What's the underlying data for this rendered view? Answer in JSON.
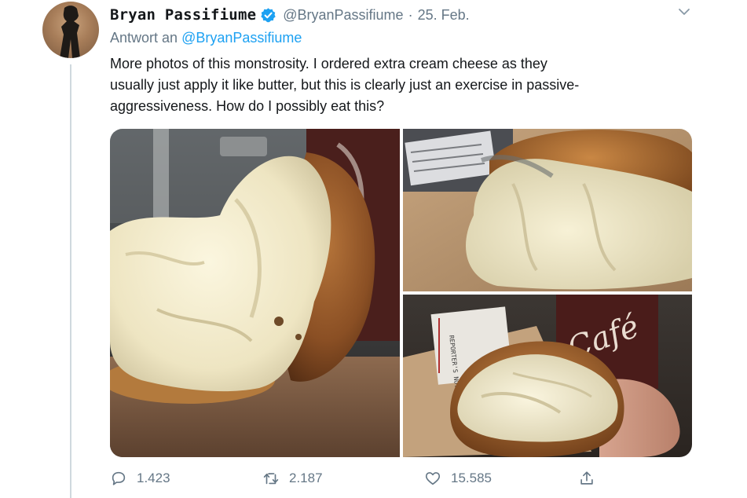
{
  "tweet": {
    "display_name": "Bryan Passifiume",
    "handle": "@BryanPassifiume",
    "separator": "·",
    "date": "25. Feb.",
    "reply_prefix": "Antwort an",
    "reply_mention": "@BryanPassifiume",
    "text_lines": [
      "More photos of this monstrosity. I ordered extra cream cheese as they",
      "usually just apply it like butter, but this is clearly just an exercise in passive-",
      "aggressiveness. How do I possibly eat this?"
    ],
    "verified": true
  },
  "media": {
    "photos": [
      {
        "subject": "bagel with heaped cream cheese, side view"
      },
      {
        "subject": "bagel with cream cheese, close-up"
      },
      {
        "subject": "bagel held in hand in front of café cup and notepad"
      }
    ],
    "cup_label": "Café",
    "notepad_text": "REPORTER'S NOTEBOOK"
  },
  "actions": {
    "reply_count": "1.423",
    "retweet_count": "2.187",
    "like_count": "15.585"
  },
  "colors": {
    "accent": "#1da1f2",
    "text": "#14171a",
    "secondary": "#657786"
  },
  "icons": {
    "verified": "verified-badge-icon",
    "caret": "chevron-down-icon",
    "reply": "reply-icon",
    "retweet": "retweet-icon",
    "like": "heart-icon",
    "share": "share-icon"
  }
}
